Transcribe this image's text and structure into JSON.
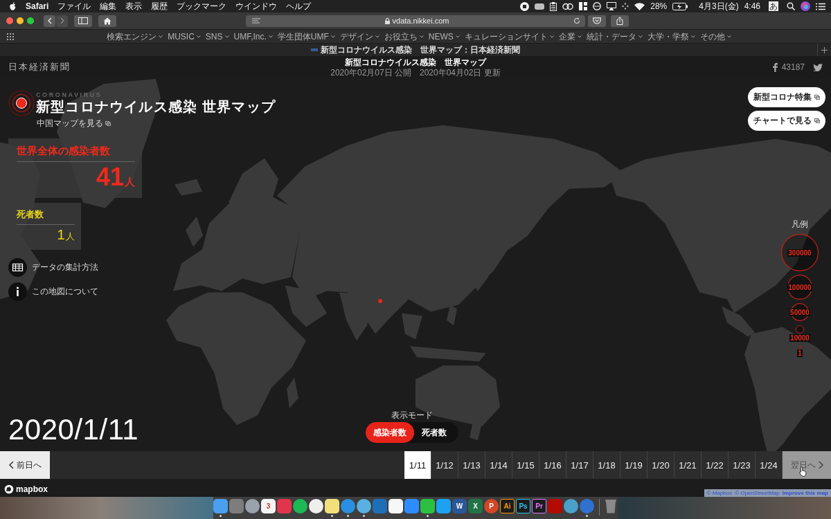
{
  "menu_bar": {
    "app": "Safari",
    "menus": [
      "ファイル",
      "編集",
      "表示",
      "履歴",
      "ブックマーク",
      "ウインドウ",
      "ヘルプ"
    ],
    "battery": "28%",
    "date": "4月3日(金)",
    "time": "4:46",
    "input_mode": "あ"
  },
  "browser": {
    "url": "vdata.nikkei.com",
    "bookmarks": [
      "検索エンジン",
      "MUSIC",
      "SNS",
      "UMF,Inc.",
      "学生団体UMF",
      "デザイン",
      "お役立ち",
      "NEWS",
      "キュレーションサイト",
      "企業",
      "統計・データ",
      "大学・学祭",
      "その他"
    ],
    "tab_title": "新型コロナウイルス感染　世界マップ：日本経済新聞"
  },
  "header": {
    "logo": "日本経済新聞",
    "title": "新型コロナウイルス感染　世界マップ",
    "published": "2020年02月07日 公開",
    "updated": "2020年04月02日 更新",
    "share_count": "43187"
  },
  "intro": {
    "kicker": "CORONAVIRUS",
    "title": "新型コロナウイルス感染 世界マップ",
    "link": "中国マップを見る"
  },
  "stats": [
    {
      "kind": "cases",
      "label": "世界全体の感染者数",
      "value": "41",
      "unit": "人"
    },
    {
      "kind": "deaths",
      "label": "死者数",
      "value": "1",
      "unit": "人"
    }
  ],
  "info_links": [
    {
      "kind": "table",
      "label": "データの集計方法"
    },
    {
      "kind": "info",
      "label": "この地図について"
    }
  ],
  "feature_links": [
    "新型コロナ特集",
    "チャートで見る"
  ],
  "legend": {
    "title": "凡例",
    "items": [
      "300000",
      "100000",
      "50000",
      "10000",
      "1"
    ]
  },
  "current_date": "2020/1/11",
  "display_mode": {
    "label": "表示モード",
    "options": [
      {
        "label": "感染者数",
        "selected": true
      },
      {
        "label": "死者数",
        "selected": false
      }
    ]
  },
  "timeline": {
    "prev": "前日へ",
    "next": {
      "label": "翌日へ",
      "hovered": true
    },
    "dates": [
      {
        "label": "1/11",
        "selected": true
      },
      {
        "label": "1/12",
        "selected": false
      },
      {
        "label": "1/13",
        "selected": false
      },
      {
        "label": "1/14",
        "selected": false
      },
      {
        "label": "1/15",
        "selected": false
      },
      {
        "label": "1/16",
        "selected": false
      },
      {
        "label": "1/17",
        "selected": false
      },
      {
        "label": "1/18",
        "selected": false
      },
      {
        "label": "1/19",
        "selected": false
      },
      {
        "label": "1/20",
        "selected": false
      },
      {
        "label": "1/21",
        "selected": false
      },
      {
        "label": "1/22",
        "selected": false
      },
      {
        "label": "1/23",
        "selected": false
      },
      {
        "label": "1/24",
        "selected": false
      }
    ]
  },
  "attribution": {
    "logo": "mapbox",
    "links": [
      "© Mapbox",
      "© OpenStreetMap",
      "Improve this map"
    ]
  },
  "dock": [
    {
      "kind": "tile",
      "color": "#4a9ff0",
      "running": true
    },
    {
      "kind": "tile",
      "color": "#7d7d7d",
      "running": false
    },
    {
      "kind": "round",
      "color": "#9aa2ac",
      "running": false
    },
    {
      "kind": "tile",
      "color": "#f4f4f4",
      "glyph": "3",
      "running": false
    },
    {
      "kind": "tile",
      "color": "#e0354a",
      "running": false
    },
    {
      "kind": "round",
      "color": "#1db954",
      "running": false
    },
    {
      "kind": "round",
      "color": "#eeeeee",
      "running": false
    },
    {
      "kind": "tile",
      "color": "#f3e07a",
      "running": true
    },
    {
      "kind": "round",
      "color": "#2a8fe0",
      "running": true
    },
    {
      "kind": "round",
      "color": "#5ab0e0",
      "running": true
    },
    {
      "kind": "tile",
      "color": "#1f6fb8",
      "running": false
    },
    {
      "kind": "tile",
      "color": "#f7f7f7",
      "running": false
    },
    {
      "kind": "tile",
      "color": "#2d8cff",
      "running": false
    },
    {
      "kind": "tile",
      "color": "#2bc042",
      "running": true
    },
    {
      "kind": "tile",
      "color": "#1da1f2",
      "running": false
    },
    {
      "kind": "tile",
      "color": "#2b579a",
      "glyph": "W",
      "running": false
    },
    {
      "kind": "tile",
      "color": "#217346",
      "glyph": "X",
      "running": false
    },
    {
      "kind": "round",
      "color": "#d24726",
      "glyph": "P",
      "running": false
    },
    {
      "kind": "adobe",
      "color": "#ff9a00",
      "glyph": "Ai",
      "running": false
    },
    {
      "kind": "adobe",
      "color": "#31c5f0",
      "glyph": "Ps",
      "running": false
    },
    {
      "kind": "adobe",
      "color": "#e579ff",
      "glyph": "Pr",
      "running": false
    },
    {
      "kind": "tile",
      "color": "#b30b00",
      "running": false
    },
    {
      "kind": "round",
      "color": "#4aa0c8",
      "running": false
    },
    {
      "kind": "round",
      "color": "#3070d0",
      "running": true
    },
    {
      "kind": "trash",
      "color": "#8a8a8a",
      "running": false
    }
  ]
}
